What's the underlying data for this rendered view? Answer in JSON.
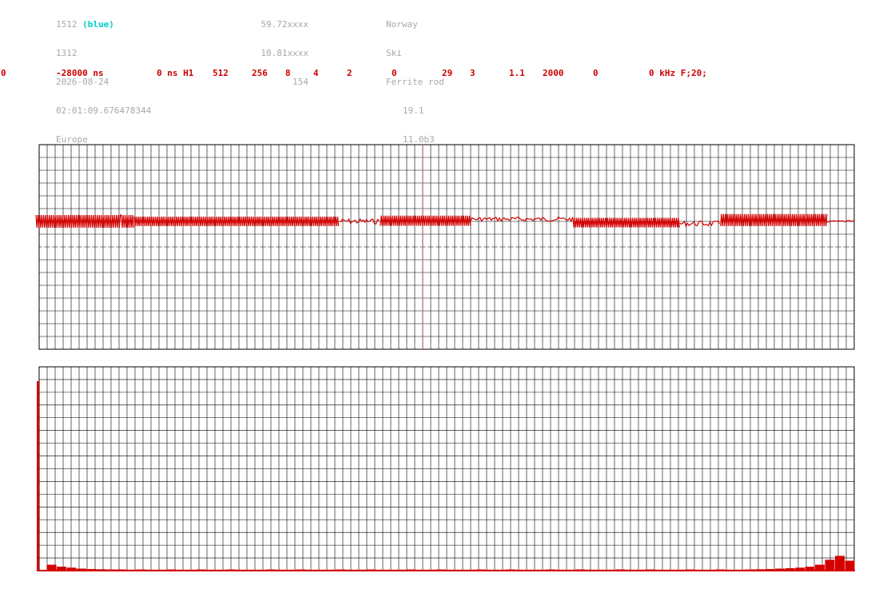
{
  "header": {
    "col1": [
      "1512",
      "1312",
      "2026-08-24",
      "02:01:09.676478344",
      "Europe"
    ],
    "col1_tag": "(blue)",
    "col2": [
      "59.72xxxx",
      "10.81xxxx",
      "154"
    ],
    "col3": [
      "Norway",
      "Ski",
      "Ferrite rod"
    ],
    "col3_sub": [
      "19.1",
      "11.0b3"
    ]
  },
  "params": [
    "0",
    "-28000 ns",
    "0 ns H1",
    "512",
    "256",
    "8",
    "4",
    "2",
    "0",
    "29",
    "3",
    "1.1",
    "2000",
    "0",
    "0 kHz F;20;"
  ],
  "colors": {
    "trace": "#d40000",
    "grid": "#000000",
    "header_text": "#a8a8a8",
    "tag": "#00cccc",
    "marker": "#ff9a9a"
  },
  "chart_data": [
    {
      "type": "line",
      "title": "",
      "xlabel": "",
      "ylabel": "",
      "grid": true,
      "marker_x": 0.47,
      "segments": [
        {
          "x": [
            0.0,
            0.12
          ],
          "level": 0.0,
          "amplitude": 1.0,
          "style": "burst"
        },
        {
          "x": [
            0.12,
            0.37
          ],
          "level": 0.0,
          "amplitude": 0.75,
          "style": "burst"
        },
        {
          "x": [
            0.37,
            0.42
          ],
          "level": 0.0,
          "amplitude": 0.3,
          "style": "noise"
        },
        {
          "x": [
            0.42,
            0.53
          ],
          "level": 0.1,
          "amplitude": 0.8,
          "style": "burst"
        },
        {
          "x": [
            0.53,
            0.655
          ],
          "level": 0.35,
          "amplitude": 0.25,
          "style": "noise"
        },
        {
          "x": [
            0.655,
            0.785
          ],
          "level": -0.2,
          "amplitude": 0.75,
          "style": "burst"
        },
        {
          "x": [
            0.785,
            0.835
          ],
          "level": -0.35,
          "amplitude": 0.3,
          "style": "noise"
        },
        {
          "x": [
            0.835,
            0.965
          ],
          "level": 0.2,
          "amplitude": 0.95,
          "style": "burst"
        },
        {
          "x": [
            0.965,
            1.0
          ],
          "level": 0.0,
          "amplitude": 0.1,
          "style": "noise"
        }
      ]
    },
    {
      "type": "bar",
      "title": "",
      "xlabel": "",
      "ylabel": "",
      "grid": true,
      "ylim": [
        0,
        1
      ],
      "values": [
        0.96,
        0.03,
        0.02,
        0.015,
        0.01,
        0.008,
        0.007,
        0.006,
        0.006,
        0.005,
        0.006,
        0.005,
        0.005,
        0.006,
        0.005,
        0.005,
        0.006,
        0.005,
        0.005,
        0.006,
        0.005,
        0.005,
        0.005,
        0.006,
        0.005,
        0.005,
        0.006,
        0.005,
        0.005,
        0.005,
        0.006,
        0.005,
        0.005,
        0.006,
        0.005,
        0.005,
        0.005,
        0.006,
        0.005,
        0.005,
        0.006,
        0.005,
        0.005,
        0.005,
        0.006,
        0.005,
        0.005,
        0.006,
        0.005,
        0.005,
        0.005,
        0.006,
        0.005,
        0.005,
        0.006,
        0.005,
        0.005,
        0.005,
        0.006,
        0.005,
        0.005,
        0.006,
        0.005,
        0.005,
        0.005,
        0.006,
        0.005,
        0.005,
        0.006,
        0.005,
        0.005,
        0.006,
        0.007,
        0.008,
        0.01,
        0.012,
        0.015,
        0.02,
        0.03,
        0.055,
        0.075,
        0.05
      ]
    }
  ]
}
